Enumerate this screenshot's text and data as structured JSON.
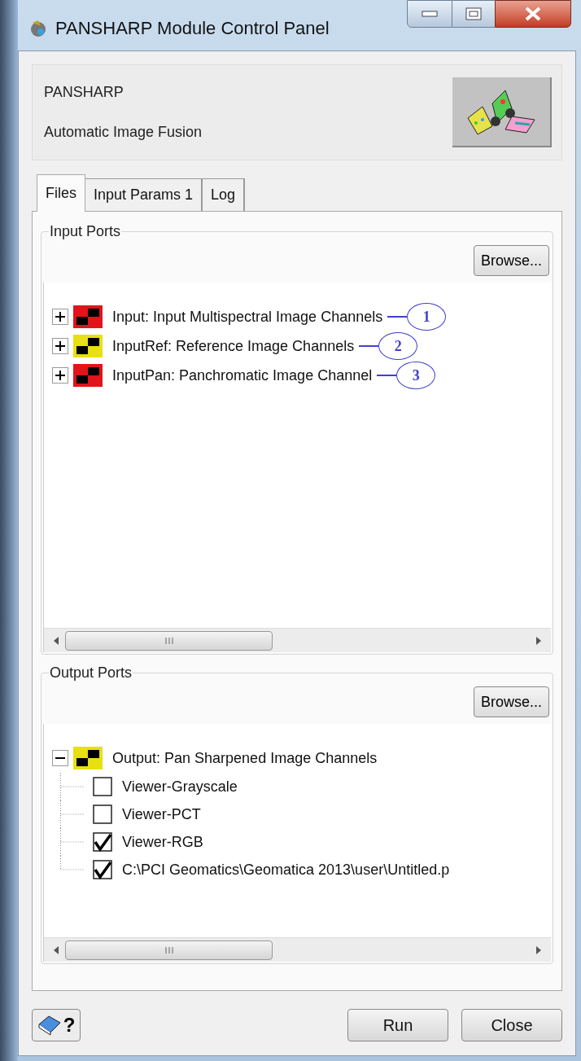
{
  "window": {
    "title": "PANSHARP Module Control Panel"
  },
  "header": {
    "title": "PANSHARP",
    "subtitle": "Automatic Image Fusion"
  },
  "tabs": [
    {
      "label": "Files",
      "selected": true
    },
    {
      "label": "Input Params 1",
      "selected": false
    },
    {
      "label": "Log",
      "selected": false
    }
  ],
  "input_ports": {
    "title": "Input Ports",
    "browse": "Browse...",
    "items": [
      {
        "label": "Input: Input Multispectral Image Channels",
        "color": "#e0141a",
        "expanded": false,
        "callout": "1"
      },
      {
        "label": "InputRef: Reference Image Channels",
        "color": "#e8e010",
        "expanded": false,
        "callout": "2"
      },
      {
        "label": "InputPan: Panchromatic Image Channel",
        "color": "#e0141a",
        "expanded": false,
        "callout": "3"
      }
    ]
  },
  "output_ports": {
    "title": "Output Ports",
    "browse": "Browse...",
    "items": [
      {
        "label": "Output: Pan Sharpened Image Channels",
        "color": "#e8e010",
        "expanded": true,
        "children": [
          {
            "label": "Viewer-Grayscale",
            "checked": false
          },
          {
            "label": "Viewer-PCT",
            "checked": false
          },
          {
            "label": "Viewer-RGB",
            "checked": true
          },
          {
            "label": "C:\\PCI Geomatics\\Geomatica 2013\\user\\Untitled.p",
            "checked": true
          }
        ]
      }
    ]
  },
  "footer": {
    "help": "?",
    "buttons": [
      "Run",
      "Close"
    ]
  }
}
